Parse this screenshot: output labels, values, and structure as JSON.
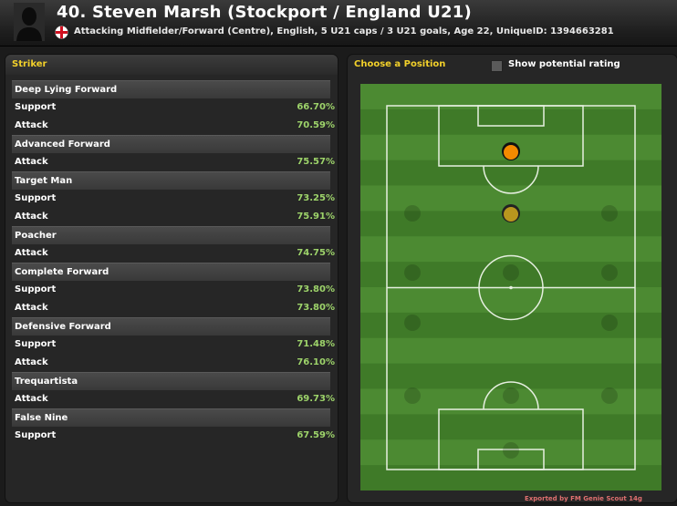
{
  "header": {
    "title": "40. Steven Marsh (Stockport / England U21)",
    "subtitle": "Attacking Midfielder/Forward (Centre), English, 5 U21 caps / 3 U21 goals, Age 22, UniqueID: 1394663281"
  },
  "left_panel": {
    "title": "Striker",
    "roles": [
      {
        "name": "Deep Lying Forward",
        "duties": [
          {
            "duty": "Support",
            "pct": "66.70%"
          },
          {
            "duty": "Attack",
            "pct": "70.59%"
          }
        ]
      },
      {
        "name": "Advanced Forward",
        "duties": [
          {
            "duty": "Attack",
            "pct": "75.57%"
          }
        ]
      },
      {
        "name": "Target Man",
        "duties": [
          {
            "duty": "Support",
            "pct": "73.25%"
          },
          {
            "duty": "Attack",
            "pct": "75.91%"
          }
        ]
      },
      {
        "name": "Poacher",
        "duties": [
          {
            "duty": "Attack",
            "pct": "74.75%"
          }
        ]
      },
      {
        "name": "Complete Forward",
        "duties": [
          {
            "duty": "Support",
            "pct": "73.80%"
          },
          {
            "duty": "Attack",
            "pct": "73.80%"
          }
        ]
      },
      {
        "name": "Defensive Forward",
        "duties": [
          {
            "duty": "Support",
            "pct": "71.48%"
          },
          {
            "duty": "Attack",
            "pct": "76.10%"
          }
        ]
      },
      {
        "name": "Trequartista",
        "duties": [
          {
            "duty": "Attack",
            "pct": "69.73%"
          }
        ]
      },
      {
        "name": "False Nine",
        "duties": [
          {
            "duty": "Support",
            "pct": "67.59%"
          }
        ]
      }
    ]
  },
  "right_panel": {
    "title": "Choose a Position",
    "checkbox_label": "Show potential rating",
    "checkbox_checked": false
  },
  "colors": {
    "accent_yellow": "#f2d02a",
    "percent_green": "#9dd36a",
    "pitch_light": "#4c8a32",
    "pitch_dark": "#3f7a28",
    "natural_position": "#f58a00",
    "accomplished_position": "#b8961e",
    "footer_red": "#e07070"
  },
  "pitch": {
    "positions": [
      {
        "name": "striker",
        "state": "natural"
      },
      {
        "name": "attacking-midfielder-centre",
        "state": "accomplished"
      }
    ]
  },
  "footer": {
    "export_text": "Exported by FM Genie Scout 14g"
  }
}
